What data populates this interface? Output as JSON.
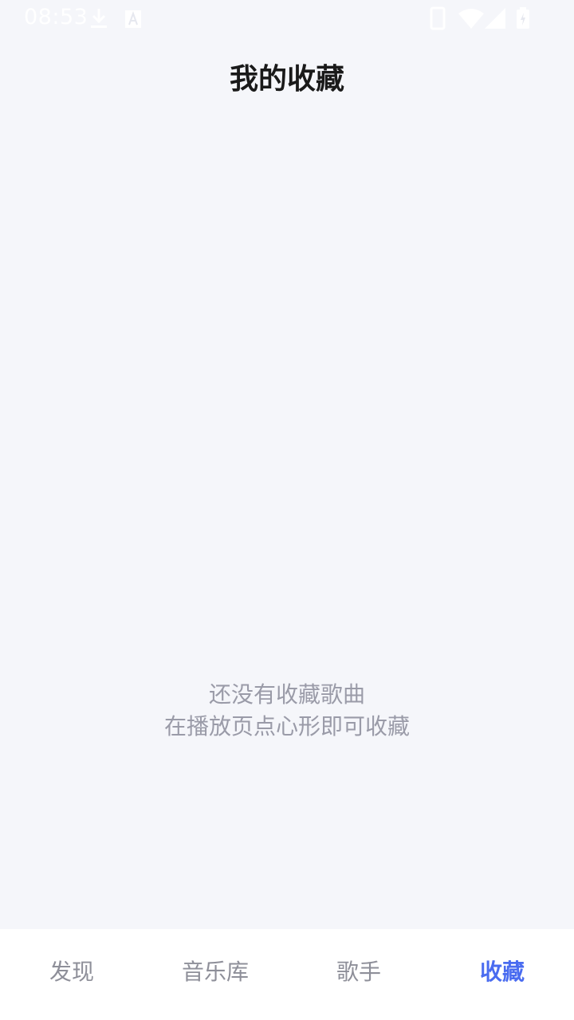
{
  "status_bar": {
    "time": "08:53",
    "icons": [
      "download-icon",
      "a-notification-icon",
      "phone-icon",
      "wifi-icon",
      "signal-icon",
      "battery-icon"
    ]
  },
  "header": {
    "title": "我的收藏"
  },
  "empty_state": {
    "line1": "还没有收藏歌曲",
    "line2": "在播放页点心形即可收藏"
  },
  "bottom_nav": {
    "tabs": [
      {
        "label": "发现"
      },
      {
        "label": "音乐库"
      },
      {
        "label": "歌手"
      },
      {
        "label": "收藏"
      }
    ],
    "active_index": 3,
    "active_color": "#4a6cf0",
    "inactive_color": "#8e8f99"
  }
}
